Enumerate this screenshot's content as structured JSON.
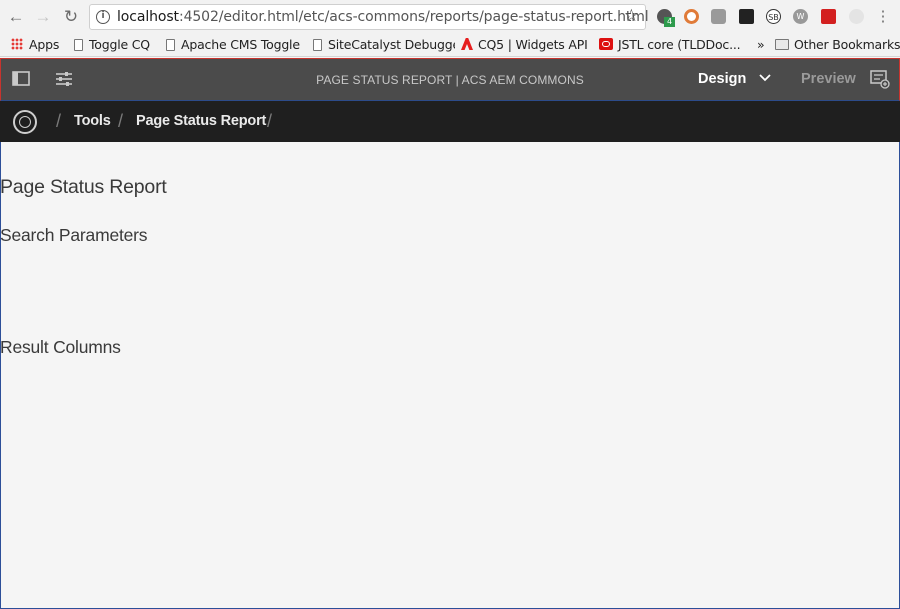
{
  "browser": {
    "url_host": "localhost",
    "url_rest": ":4502/editor.html/etc/acs-commons/reports/page-status-report.html",
    "extension_badge": "4",
    "bookmarks": [
      {
        "label": "Apps",
        "icon": "apps-grid-icon"
      },
      {
        "label": "Toggle CQ",
        "icon": "page-icon"
      },
      {
        "label": "Apache CMS Toggle",
        "icon": "page-icon"
      },
      {
        "label": "SiteCatalyst Debugger",
        "icon": "page-icon"
      },
      {
        "label": "CQ5 | Widgets API",
        "icon": "adobe-icon"
      },
      {
        "label": "JSTL core (TLDDoc...",
        "icon": "oracle-icon"
      },
      {
        "label": "Other Bookmarks",
        "icon": "folder-icon"
      }
    ],
    "overflow": "»"
  },
  "editor": {
    "title": "PAGE STATUS REPORT | ACS AEM COMMONS",
    "mode": "Design",
    "preview": "Preview"
  },
  "breadcrumb": {
    "items": [
      "Tools",
      "Page Status Report"
    ]
  },
  "page": {
    "title": "Page Status Report",
    "section_search": "Search Parameters",
    "section_results": "Result Columns"
  },
  "colors": {
    "editor_header": "#4b4b4b",
    "breadcrumb_bar": "#1f1f1f",
    "page_bg": "#f5f5f5"
  }
}
